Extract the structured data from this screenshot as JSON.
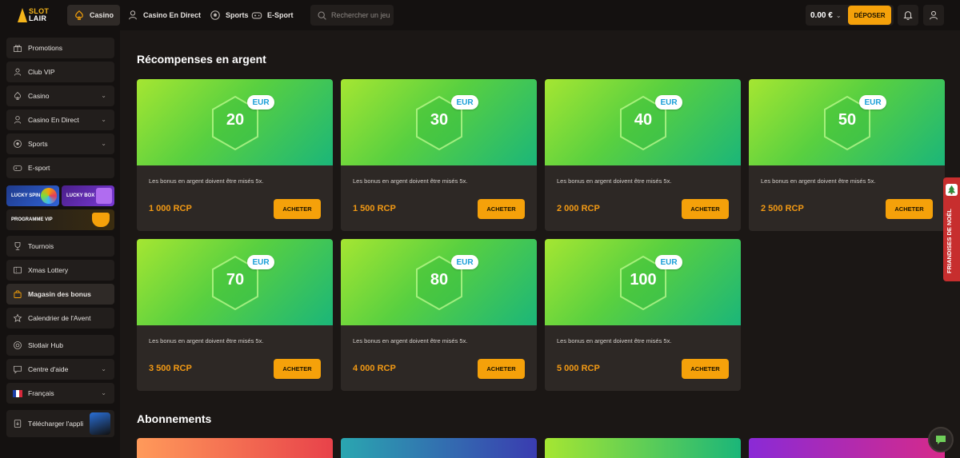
{
  "header": {
    "logo_top": "SLOT",
    "logo_bottom": "LAIR",
    "nav": [
      {
        "label": "Casino",
        "icon": "spade-icon"
      },
      {
        "label": "Casino En Direct",
        "icon": "dealer-icon"
      },
      {
        "label": "Sports",
        "icon": "football-icon"
      },
      {
        "label": "E-Sport",
        "icon": "gamepad-icon"
      }
    ],
    "search_placeholder": "Rechercher un jeu",
    "balance": "0.00 €",
    "deposit_label": "DÉPOSER"
  },
  "sidebar": {
    "items": [
      {
        "label": "Promotions",
        "icon": "gift-icon"
      },
      {
        "label": "Club VIP",
        "icon": "user-icon"
      },
      {
        "label": "Casino",
        "icon": "spade-icon"
      },
      {
        "label": "Casino En Direct",
        "icon": "dealer-icon"
      },
      {
        "label": "Sports",
        "icon": "football-icon"
      },
      {
        "label": "E-sport",
        "icon": "gamepad-icon"
      },
      {
        "label": "Tournois",
        "icon": "trophy-icon"
      },
      {
        "label": "Xmas Lottery",
        "icon": "ticket-icon"
      },
      {
        "label": "Magasin des bonus",
        "icon": "bag-icon"
      },
      {
        "label": "Calendrier de l'Avent",
        "icon": "star-icon"
      },
      {
        "label": "Slotlair Hub",
        "icon": "hub-icon"
      },
      {
        "label": "Centre d'aide",
        "icon": "chat-icon"
      },
      {
        "label": "Français",
        "icon": "france-flag-icon"
      },
      {
        "label": "Télécharger l'appli",
        "icon": "download-icon"
      }
    ],
    "lucky_spin": "LUCKY SPIN",
    "lucky_box": "LUCKY BOX",
    "vip_program": "PROGRAMME VIP"
  },
  "main": {
    "section_title": "Récompenses en argent",
    "currency_badge": "EUR",
    "description": "Les bonus en argent doivent être misés 5x.",
    "buy_label": "ACHETER",
    "cards": [
      {
        "amount": "20",
        "price": "1 000 RCP"
      },
      {
        "amount": "30",
        "price": "1 500 RCP"
      },
      {
        "amount": "40",
        "price": "2 000 RCP"
      },
      {
        "amount": "50",
        "price": "2 500 RCP"
      },
      {
        "amount": "70",
        "price": "3 500 RCP"
      },
      {
        "amount": "80",
        "price": "4 000 RCP"
      },
      {
        "amount": "100",
        "price": "5 000 RCP"
      }
    ],
    "subscriptions_title": "Abonnements"
  },
  "xmas_tab": "FRIANDISES DE NOËL",
  "colors": {
    "accent": "#f5a10a",
    "price": "#f39a14",
    "card_bg": "#2d2825",
    "page_bg": "#1b1715"
  }
}
